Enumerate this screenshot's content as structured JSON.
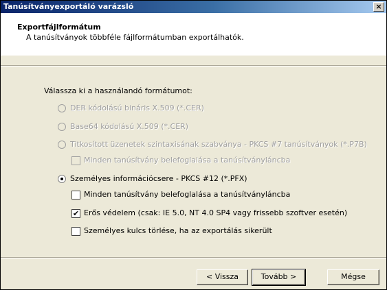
{
  "window": {
    "title": "Tanúsítványexportáló varázsló",
    "close_glyph": "×"
  },
  "header": {
    "title": "Exportfájlformátum",
    "subtitle": "A tanúsítványok többféle fájlformátumban exportálhatók."
  },
  "prompt": "Válassza ki a használandó formátumot:",
  "options": {
    "der": {
      "label": "DER kódolású bináris X.509 (*.CER)",
      "enabled": false,
      "selected": false
    },
    "base64": {
      "label": "Base64 kódolású X.509 (*.CER)",
      "enabled": false,
      "selected": false
    },
    "pkcs7": {
      "label": "Titkosított üzenetek szintaxisának szabványa - PKCS #7 tanúsítványok (*.P7B)",
      "enabled": false,
      "selected": false
    },
    "pkcs7_include": {
      "label": "Minden tanúsítvány belefoglalása a tanúsítványláncba",
      "enabled": false,
      "checked": false
    },
    "pfx": {
      "label": "Személyes információcsere - PKCS #12 (*.PFX)",
      "enabled": true,
      "selected": true
    },
    "pfx_include": {
      "label": "Minden tanúsítvány belefoglalása a tanúsítványláncba",
      "enabled": true,
      "checked": false
    },
    "pfx_strong": {
      "label": "Erős védelem (csak: IE 5.0, NT 4.0 SP4 vagy frissebb szoftver esetén)",
      "enabled": true,
      "checked": true
    },
    "pfx_delete_key": {
      "label": "Személyes kulcs törlése, ha az exportálás sikerült",
      "enabled": true,
      "checked": false
    }
  },
  "buttons": {
    "back": "< Vissza",
    "next": "Tovább >",
    "cancel": "Mégse"
  },
  "check_glyph": "✔"
}
